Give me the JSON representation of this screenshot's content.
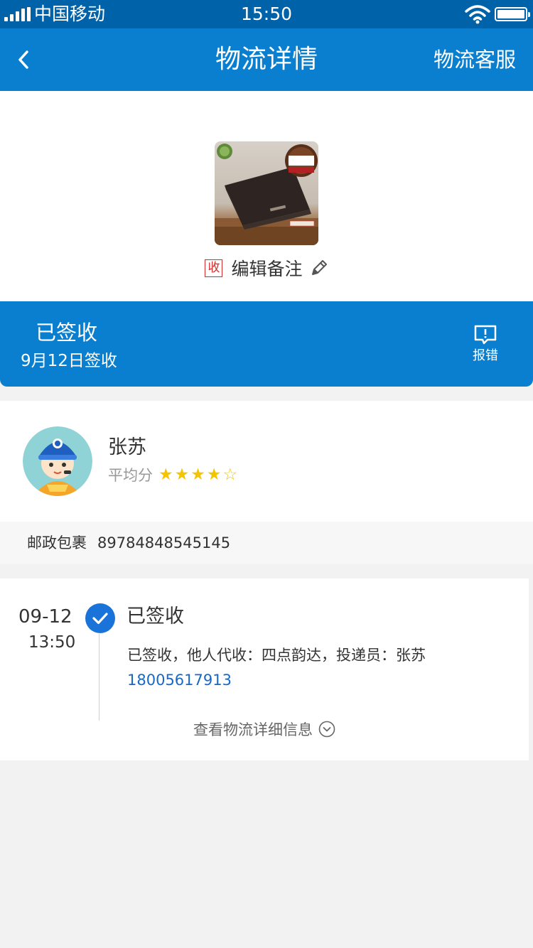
{
  "status_bar": {
    "carrier": "中国移动",
    "time": "15:50",
    "icons": [
      "signal-icon",
      "wifi-icon",
      "battery-icon"
    ]
  },
  "nav": {
    "back_icon": "chevron-left-icon",
    "title": "物流详情",
    "service_label": "物流客服"
  },
  "product": {
    "image_icon": "wallet-product-image",
    "tag": "收",
    "remark_label": "编辑备注",
    "edit_icon": "pencil-icon"
  },
  "status": {
    "title": "已签收",
    "date": "9月12日签收",
    "report_label": "报错",
    "report_icon": "report-bubble-icon"
  },
  "courier": {
    "name": "张苏",
    "rating_label": "平均分",
    "rating": 4,
    "rating_max": 5
  },
  "tracking": {
    "company": "邮政包裹",
    "number": "89784848545145"
  },
  "timeline": {
    "date": "09-12",
    "time": "13:50",
    "event_title": "已签收",
    "event_desc": "已签收，他人代收：四点韵达，投递员：张苏",
    "phone": "18005617913",
    "more_label": "查看物流详细信息",
    "check_icon": "check-circle-icon",
    "expand_icon": "chevron-down-circle-icon"
  },
  "colors": {
    "status_bar": "#0062a8",
    "primary": "#0a7fcf",
    "star": "#f5c400",
    "link": "#1769c5",
    "tag_red": "#d62b2b"
  }
}
